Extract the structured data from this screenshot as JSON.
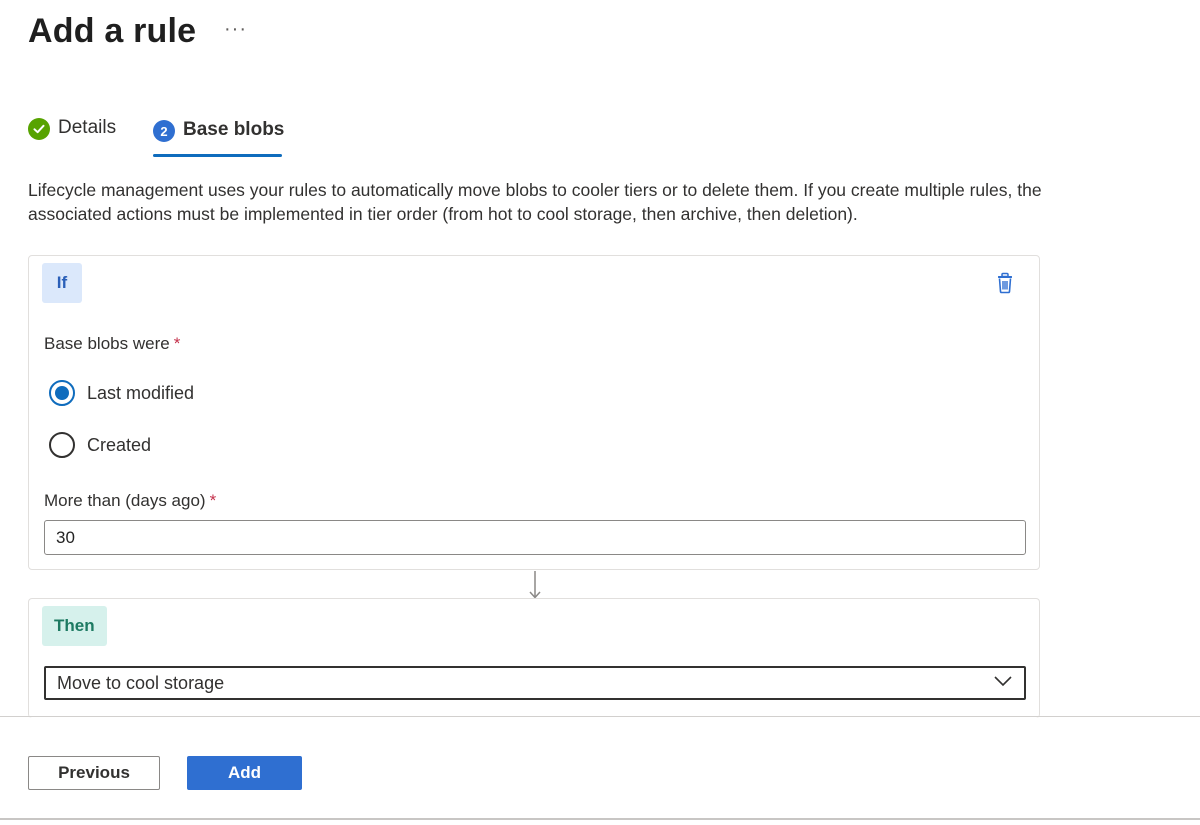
{
  "header": {
    "title": "Add a rule",
    "more_label": "···"
  },
  "tabs": [
    {
      "label": "Details",
      "state": "completed",
      "icon": "checkmark-icon"
    },
    {
      "label": "Base blobs",
      "state": "active",
      "step_number": "2"
    }
  ],
  "description": "Lifecycle management uses your rules to automatically move blobs to cooler tiers or to delete them. If you create multiple rules, the associated actions must be implemented in tier order (from hot to cool storage, then archive, then deletion).",
  "if_block": {
    "badge": "If",
    "delete_icon": "trash-icon",
    "base_blobs_label": "Base blobs were",
    "required_marker": "*",
    "options": [
      {
        "label": "Last modified",
        "selected": true
      },
      {
        "label": "Created",
        "selected": false
      }
    ],
    "days_label": "More than (days ago)",
    "days_value": "30"
  },
  "then_block": {
    "badge": "Then",
    "action_selected": "Move to cool storage",
    "dropdown_icon": "chevron-down-icon"
  },
  "footer": {
    "previous_label": "Previous",
    "add_label": "Add"
  },
  "colors": {
    "accent": "#0f6cbd",
    "primary_button": "#2f6fd1",
    "success": "#57a300",
    "required": "#c4314b",
    "if_badge_bg": "#dbe8fb",
    "then_badge_bg": "#d6f1ec"
  }
}
